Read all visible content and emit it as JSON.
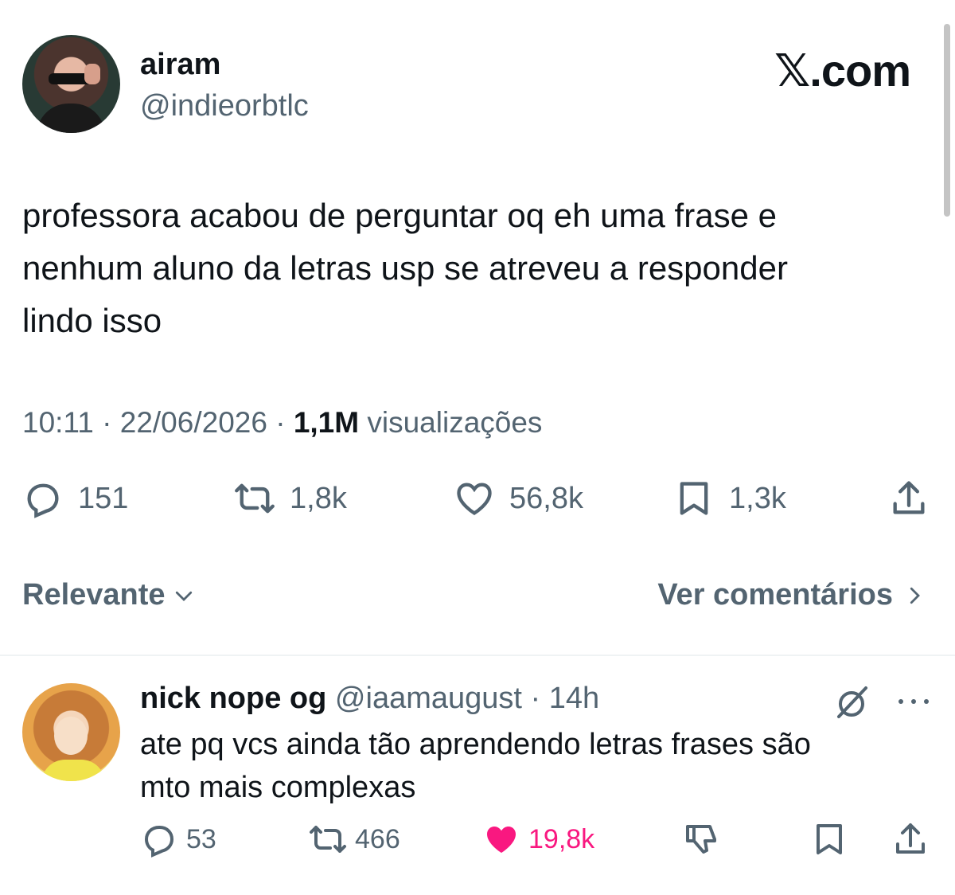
{
  "brand": {
    "prefix": "𝕏",
    "suffix": ".com"
  },
  "tweet": {
    "author": {
      "name": "airam",
      "handle": "@indieorbtlc"
    },
    "text_lines": [
      "professora acabou de perguntar oq eh uma frase e",
      "nenhum aluno da letras usp se atreveu a responder",
      "lindo isso"
    ],
    "time": "10:11",
    "date": "22/06/2026",
    "views_count": "1,1M",
    "views_label": "visualizações",
    "separator": "·",
    "stats": {
      "replies": "151",
      "reposts": "1,8k",
      "likes": "56,8k",
      "bookmarks": "1,3k"
    }
  },
  "comments_bar": {
    "sort_label": "Relevante",
    "view_label": "Ver comentários"
  },
  "reply": {
    "name": "nick nope og",
    "handle": "@iaamaugust",
    "dot": "·",
    "time": "14h",
    "text_lines": [
      "ate pq vcs ainda tão aprendendo letras frases são",
      "mto mais complexas"
    ],
    "stats": {
      "replies": "53",
      "reposts": "466",
      "likes": "19,8k"
    },
    "like_color": "#f91880"
  },
  "icons": [
    "reply-icon",
    "repost-icon",
    "like-icon",
    "bookmark-icon",
    "share-icon",
    "chevron-down-icon",
    "chevron-right-icon",
    "grok-icon",
    "more-icon",
    "dislike-icon"
  ]
}
